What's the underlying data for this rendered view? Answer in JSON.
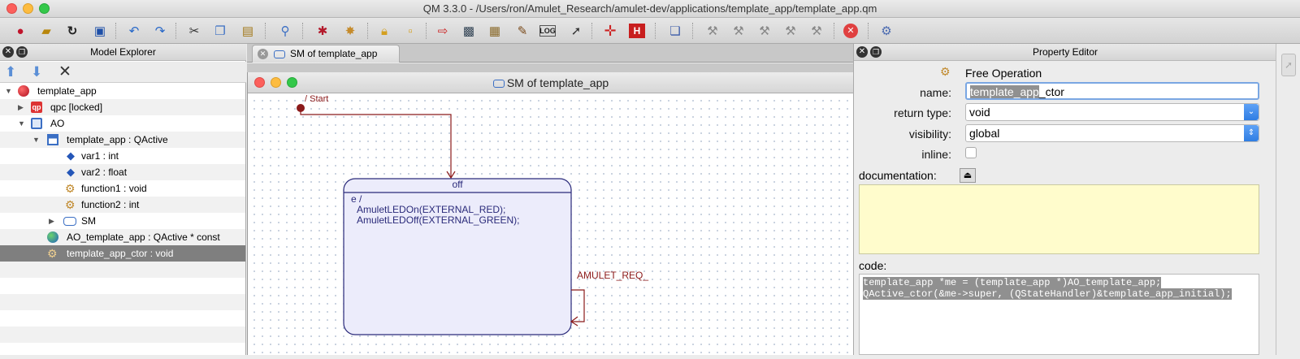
{
  "window": {
    "title": "QM 3.3.0 - /Users/ron/Amulet_Research/amulet-dev/applications/template_app/template_app.qm"
  },
  "explorer": {
    "title": "Model Explorer",
    "tree": [
      {
        "label": "template_app",
        "icon": "model-icon"
      },
      {
        "label": "qpc [locked]",
        "icon": "package-locked-icon"
      },
      {
        "label": "AO",
        "icon": "package-icon"
      },
      {
        "label": "template_app : QActive",
        "icon": "class-icon"
      },
      {
        "label": "var1 : int",
        "icon": "attribute-icon"
      },
      {
        "label": "var2 : float",
        "icon": "attribute-icon"
      },
      {
        "label": "function1 : void",
        "icon": "operation-icon"
      },
      {
        "label": "function2 : int",
        "icon": "operation-icon"
      },
      {
        "label": "SM",
        "icon": "statemachine-icon"
      },
      {
        "label": "AO_template_app : QActive * const",
        "icon": "global-attribute-icon"
      },
      {
        "label": "template_app_ctor : void",
        "icon": "free-operation-icon"
      }
    ]
  },
  "diagram": {
    "tab_label": "SM of template_app",
    "window_title": "SM of template_app",
    "initial_label": "/ Start",
    "state": {
      "name": "off",
      "entry_label": "e /",
      "entry_lines": [
        "AmuletLEDOn(EXTERNAL_RED);",
        "AmuletLEDOff(EXTERNAL_GREEN);"
      ]
    },
    "self_transition_label": "AMULET_REQ_",
    "colors": {
      "state_fill": "#ececfb",
      "state_border": "#2a2a7a",
      "transition": "#8b1a1a"
    }
  },
  "property_editor": {
    "title": "Property Editor",
    "kind": "Free Operation",
    "name_label": "name:",
    "name_value_highlight": "template_app",
    "name_value_rest": "_ctor",
    "return_type_label": "return type:",
    "return_type_value": "void",
    "visibility_label": "visibility:",
    "visibility_value": "global",
    "inline_label": "inline:",
    "documentation_label": "documentation:",
    "code_label": "code:",
    "code_lines": [
      "template_app *me = (template_app *)AO_template_app;",
      "QActive_ctor(&me->super, (QStateHandler)&template_app_initial);"
    ]
  }
}
